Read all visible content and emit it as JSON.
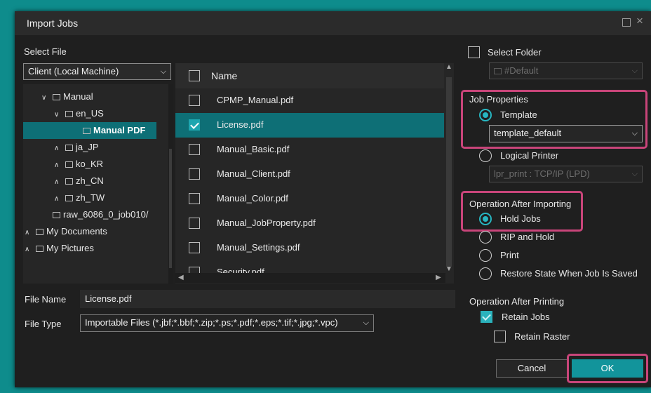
{
  "dialog": {
    "title": "Import Jobs"
  },
  "select_file": {
    "label": "Select File",
    "source": "Client (Local Machine)",
    "tree": [
      {
        "label": "Manual",
        "toggle": "open"
      },
      {
        "label": "en_US",
        "toggle": "open"
      },
      {
        "label": "Manual PDF",
        "toggle": "none",
        "selected": true
      },
      {
        "label": "ja_JP",
        "toggle": "closed"
      },
      {
        "label": "ko_KR",
        "toggle": "closed"
      },
      {
        "label": "zh_CN",
        "toggle": "closed"
      },
      {
        "label": "zh_TW",
        "toggle": "closed"
      },
      {
        "label": "raw_6086_0_job010/",
        "toggle": "none"
      },
      {
        "label": "My Documents",
        "toggle": "closed"
      },
      {
        "label": "My Pictures",
        "toggle": "closed"
      }
    ]
  },
  "file_list": {
    "column_name": "Name",
    "files": [
      {
        "name": "CPMP_Manual.pdf",
        "checked": false
      },
      {
        "name": "License.pdf",
        "checked": true,
        "selected": true
      },
      {
        "name": "Manual_Basic.pdf",
        "checked": false
      },
      {
        "name": "Manual_Client.pdf",
        "checked": false
      },
      {
        "name": "Manual_Color.pdf",
        "checked": false
      },
      {
        "name": "Manual_JobProperty.pdf",
        "checked": false
      },
      {
        "name": "Manual_Settings.pdf",
        "checked": false
      },
      {
        "name": "Security.pdf",
        "checked": false
      }
    ]
  },
  "file_name": {
    "label": "File Name",
    "value": "License.pdf"
  },
  "file_type": {
    "label": "File Type",
    "value": "Importable Files (*.jbf;*.bbf;*.zip;*.ps;*.pdf;*.eps;*.tif;*.jpg;*.vpc)"
  },
  "select_folder": {
    "label": "Select Folder",
    "checked": false,
    "value": "#Default"
  },
  "job_properties": {
    "label": "Job Properties",
    "template_label": "Template",
    "template_value": "template_default",
    "logical_printer_label": "Logical Printer",
    "logical_printer_value": "lpr_print : TCP/IP (LPD)",
    "selected": "template"
  },
  "operation_after_importing": {
    "label": "Operation After Importing",
    "options": [
      "Hold Jobs",
      "RIP and Hold",
      "Print",
      "Restore State When Job Is Saved"
    ],
    "selected": "Hold Jobs"
  },
  "operation_after_printing": {
    "label": "Operation After Printing",
    "retain_jobs": "Retain Jobs",
    "retain_jobs_checked": true,
    "retain_raster": "Retain Raster",
    "retain_raster_checked": false
  },
  "buttons": {
    "cancel": "Cancel",
    "ok": "OK"
  },
  "colors": {
    "accent": "#1ea6b0",
    "selection": "#0e6f76",
    "highlight": "#c9457a",
    "app_background": "#0e8c8c"
  }
}
